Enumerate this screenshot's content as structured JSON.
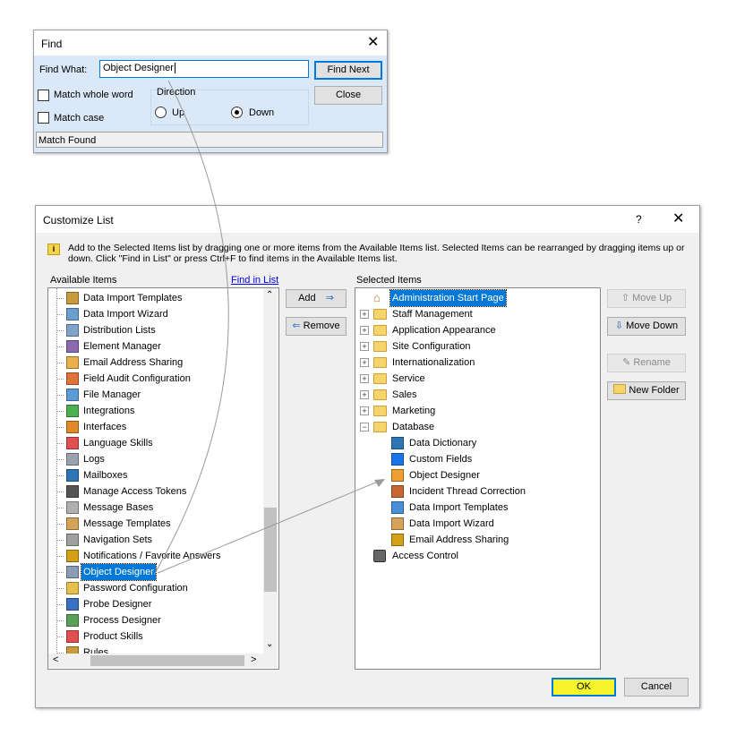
{
  "find": {
    "title": "Find",
    "find_what_label": "Find What:",
    "find_what_value": "Object Designer",
    "find_next": "Find Next",
    "close": "Close",
    "match_whole_word": "Match whole word",
    "match_case": "Match case",
    "direction": "Direction",
    "up": "Up",
    "down": "Down",
    "status": "Match Found"
  },
  "customize": {
    "title": "Customize List",
    "help": "?",
    "info": "Add to the Selected Items list by dragging one or more items from the Available Items list. Selected Items can be rearranged by dragging items up or down. Click \"Find in List\" or press Ctrl+F to find items in the Available Items list.",
    "available_label": "Available Items",
    "find_in_list": "Find in List",
    "selected_label": "Selected Items",
    "add": "Add",
    "remove": "Remove",
    "move_up": "Move Up",
    "move_down": "Move Down",
    "rename": "Rename",
    "new_folder": "New Folder",
    "ok": "OK",
    "cancel": "Cancel",
    "available_items": [
      "Data Import Templates",
      "Data Import Wizard",
      "Distribution Lists",
      "Element Manager",
      "Email Address Sharing",
      "Field Audit Configuration",
      "File Manager",
      "Integrations",
      "Interfaces",
      "Language Skills",
      "Logs",
      "Mailboxes",
      "Manage Access Tokens",
      "Message Bases",
      "Message Templates",
      "Navigation Sets",
      "Notifications / Favorite Answers",
      "Object Designer",
      "Password Configuration",
      "Probe Designer",
      "Process Designer",
      "Product Skills",
      "Rules"
    ],
    "selected_items": [
      "Administration Start Page",
      "Staff Management",
      "Application Appearance",
      "Site Configuration",
      "Internationalization",
      "Service",
      "Sales",
      "Marketing",
      "Database",
      "Data Dictionary",
      "Custom Fields",
      "Object Designer",
      "Incident Thread Correction",
      "Data Import Templates",
      "Data Import Wizard",
      "Email Address Sharing",
      "Access Control"
    ]
  }
}
